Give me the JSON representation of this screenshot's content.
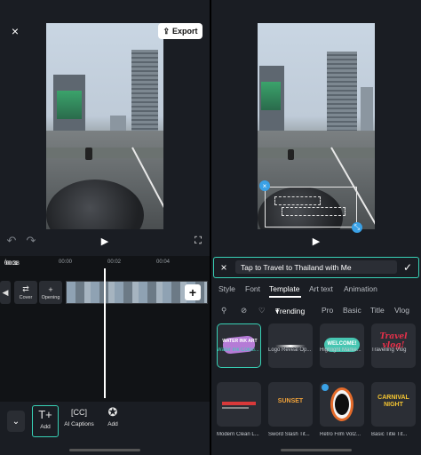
{
  "left": {
    "close_icon": "×",
    "export_label": "Export",
    "time_current": "00:01",
    "time_total": "00:38",
    "ruler_ticks": [
      "00:00",
      "00:02",
      "00:04"
    ],
    "cover_label": "Cover",
    "opening_label": "Opening",
    "tools": [
      {
        "label": "Add"
      },
      {
        "label": "AI Captions"
      },
      {
        "label": "Add"
      }
    ]
  },
  "right": {
    "text_value": "Tap to Travel to Thailand with Me",
    "tabs": [
      "Style",
      "Font",
      "Template",
      "Art text",
      "Animation"
    ],
    "filters": [
      "Trending",
      "Pro",
      "Basic",
      "Title",
      "Vlog"
    ],
    "templates": [
      {
        "label": "Water Ink Colou...",
        "preview": "WATER INK ART"
      },
      {
        "label": "Logo Reveal Op..."
      },
      {
        "label": "Highlight Marke...",
        "preview": "WELCOME!"
      },
      {
        "label": "Travelling Vlog",
        "preview": "Travel vlog!"
      },
      {
        "label": "Modern Clean L..."
      },
      {
        "label": "Sword Slash Tit...",
        "preview": "SUNSET"
      },
      {
        "label": "Retro Film Vol2..."
      },
      {
        "label": "Basic Title Tit...",
        "preview": "CARNIVAL NIGHT"
      }
    ]
  },
  "colors": {
    "accent": "#38d1b6",
    "panel": "#1a1d23",
    "handle": "#3aa1e6"
  }
}
